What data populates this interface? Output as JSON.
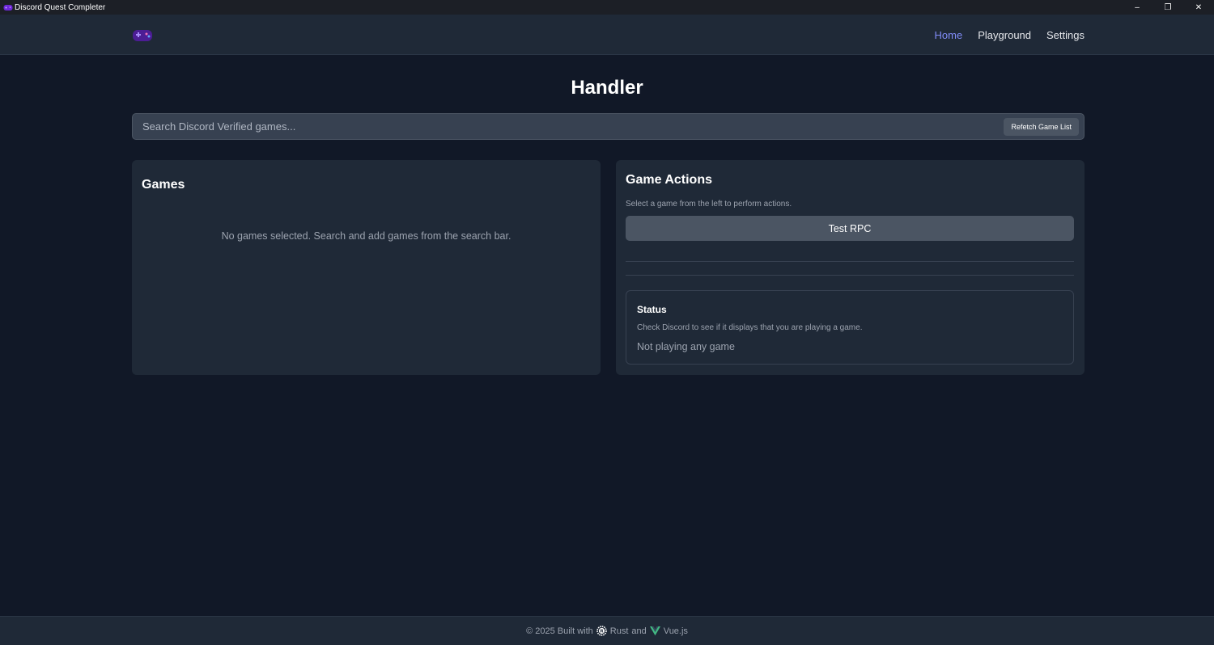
{
  "window": {
    "title": "Discord Quest Completer",
    "controls": {
      "minimize": "–",
      "restore": "❐",
      "close": "✕"
    }
  },
  "nav": {
    "links": [
      "Home",
      "Playground",
      "Settings"
    ],
    "active": "Home"
  },
  "page": {
    "title": "Handler"
  },
  "search": {
    "placeholder": "Search Discord Verified games...",
    "value": "",
    "refetch_label": "Refetch Game List"
  },
  "games_panel": {
    "heading": "Games",
    "empty_message": "No games selected. Search and add games from the search bar."
  },
  "actions_panel": {
    "heading": "Game Actions",
    "hint": "Select a game from the left to perform actions.",
    "test_rpc_label": "Test RPC"
  },
  "status": {
    "title": "Status",
    "hint": "Check Discord to see if it displays that you are playing a game.",
    "value": "Not playing any game"
  },
  "footer": {
    "prefix": "© 2025 Built with",
    "rust": "Rust",
    "and": "and",
    "vue": "Vue.js"
  },
  "colors": {
    "background": "#111827",
    "surface": "#1f2937",
    "accent": "#818cf8",
    "button": "#4b5563",
    "vue_green": "#42b883"
  },
  "icons": {
    "app": "gamepad-icon",
    "rust": "rust-logo-icon",
    "vue": "vue-logo-icon"
  }
}
